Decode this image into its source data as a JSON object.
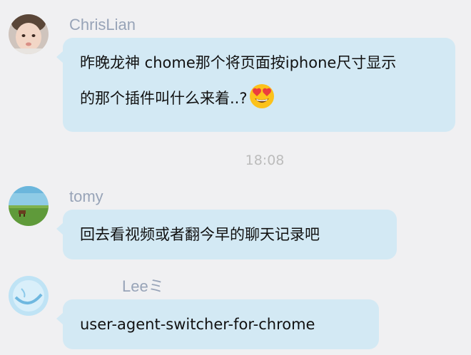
{
  "messages": [
    {
      "sender": "ChrisLian",
      "avatar_icon": "baby-avatar-icon",
      "lines": [
        "昨晚龙神 chome那个将页面按iphone尺寸显示",
        "的那个插件叫什么来着..?"
      ],
      "emoji_icon": "heart-eyes-emoji-icon"
    },
    {
      "sender": "tomy",
      "avatar_icon": "landscape-avatar-icon",
      "lines": [
        "回去看视频或者翻今早的聊天记录吧"
      ]
    },
    {
      "sender": "Leeミ",
      "avatar_icon": "blue-swirl-avatar-icon",
      "lines": [
        "user-agent-switcher-for-chrome"
      ]
    }
  ],
  "timestamp": "18:08",
  "colors": {
    "background": "#f0f0f2",
    "bubble": "#d3e9f4",
    "sender_name": "#98a4b8",
    "timestamp": "#bcbcbc"
  }
}
